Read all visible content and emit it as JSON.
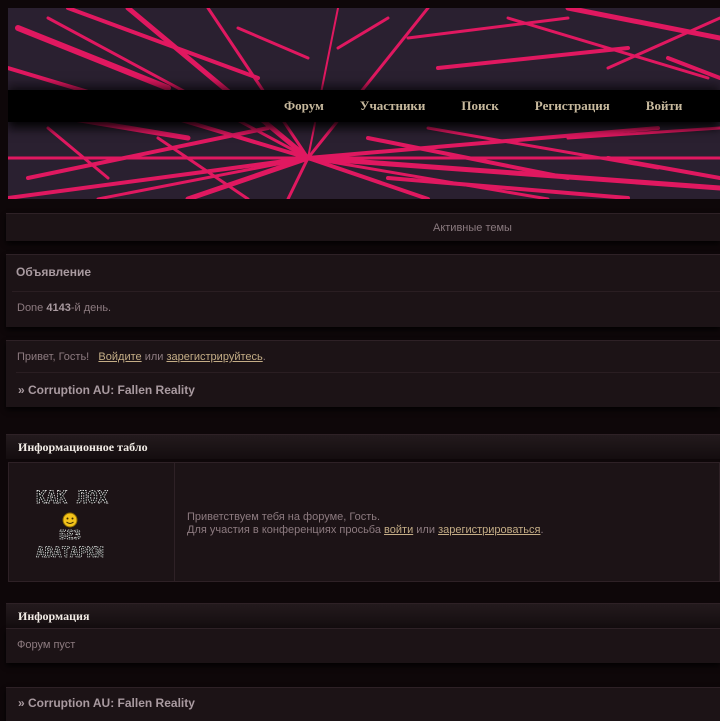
{
  "nav": {
    "items": [
      "Форум",
      "Участники",
      "Поиск",
      "Регистрация",
      "Войти"
    ]
  },
  "active_topics": "Активные темы",
  "announcement": {
    "title": "Объявление",
    "prefix": "Done ",
    "number": "4143",
    "suffix": "-й день."
  },
  "welcome": {
    "greeting": "Привет, Гость!",
    "login_link": "Войдите",
    "or": "или",
    "register_link": "зарегистрируйтесь",
    "period": ".",
    "crumb": "» Corruption AU: Fallen Reality"
  },
  "info_board": {
    "title": "Информационное табло",
    "avatar_line1": "КАК ЛОХ",
    "avatar_line2": "БЕЗ",
    "avatar_line3": "АВАТАРКИ",
    "line1": "Приветствуем тебя на форуме, Гость.",
    "line2_prefix": "Для участия в конференциях просьба",
    "login_link": "войти",
    "or": "или",
    "register_link": "зарегистрироваться",
    "period": "."
  },
  "information": {
    "title": "Информация",
    "text": "Форум пуст"
  },
  "footer_crumb": "» Corruption AU: Fallen Reality",
  "colors": {
    "accent": "#e01860",
    "link": "#c4ad86",
    "background": "#0e0709",
    "panel": "#1c1316"
  }
}
